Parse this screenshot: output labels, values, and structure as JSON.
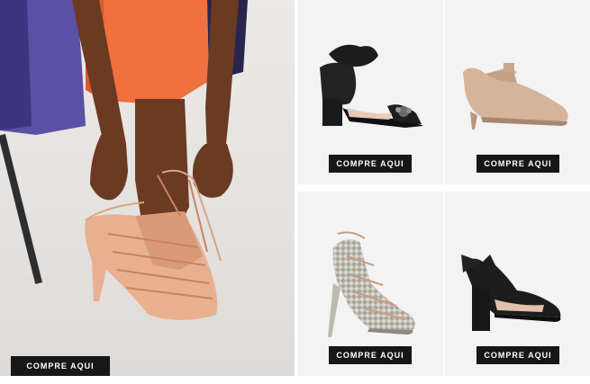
{
  "hero": {
    "cta_label": "COMPRE AQUI",
    "image_alt": "model-tying-nude-lace-up-heels"
  },
  "products": [
    {
      "cta_label": "COMPRE AQUI",
      "image": "black-ankle-bow-block-heel-sandal-icon"
    },
    {
      "cta_label": "COMPRE AQUI",
      "image": "nude-kitten-heel-ankle-strap-pump-icon"
    },
    {
      "cta_label": "COMPRE AQUI",
      "image": "snakeskin-lace-up-heel-sandal-icon"
    },
    {
      "cta_label": "COMPRE AQUI",
      "image": "black-bow-block-heel-sandal-icon"
    }
  ],
  "colors": {
    "button_bg": "#171717",
    "button_text": "#ffffff",
    "tile_bg": "#f3f3f3",
    "dress_orange": "#f0703f",
    "dress_purple": "#5b4fa6"
  }
}
